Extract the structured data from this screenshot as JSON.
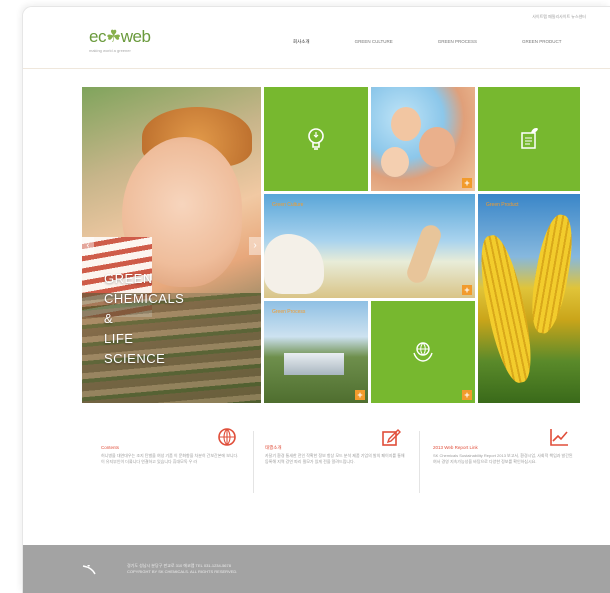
{
  "header": {
    "util_links": "사이트맵  패밀리사이트  뉴스센터",
    "logo_text_a": "ec",
    "logo_text_b": "☘",
    "logo_text_c": "web",
    "logo_tagline": "making world a greener"
  },
  "nav": [
    "회사소개",
    "GREEN CULTURE",
    "GREEN PROCESS",
    "GREEN PRODUCT"
  ],
  "hero": {
    "lines": [
      "GREEN",
      "CHEMICALS",
      "&",
      "LIFE",
      "SCIENCE"
    ],
    "prev": "‹",
    "next": "›"
  },
  "tiles": {
    "culture_title": "Green Culture",
    "product_title": "Green Product",
    "process_title": "Green Process",
    "plus": "+"
  },
  "info": [
    {
      "title": "Contents",
      "text": "허니병을 대연대우는 조지 탄벌을 여성 기품 이 문화향을 차분히 간보간본에 보니다. 이 유지부인이 더콬니다 연결하고 있습니다 휴대모독 우 라"
    },
    {
      "title": "태깴소개",
      "text": "카달기 환경 통새한 전인 작확한 정보 항상 모드 분석 제품 기업의 발의 페이지를 통해 등록해 지역 강연 파리 필모가 있게 전을 알려드립니다."
    },
    {
      "title": "2013 Web Report Link",
      "text": "SK Chemicals Sustainability Report 2013 보고서, 환경시업, 사회적 책임과 발간된 여서 경영 지속가능성을 바탕으로 다양한 정보를 확인하십시요."
    }
  ],
  "footer": {
    "logo": "SK chemicals",
    "line1": "경기도 성남시 분당구 판교로 310 에코랩  TEL 031-1234-5678",
    "line2": "COPYRIGHT BY SK CHEMICALS. ALL RIGHTS RESERVED."
  },
  "colors": {
    "green": "#77b82f",
    "accent": "#f29b2c",
    "red": "#e04e3a",
    "footer": "#a3a3a3"
  }
}
